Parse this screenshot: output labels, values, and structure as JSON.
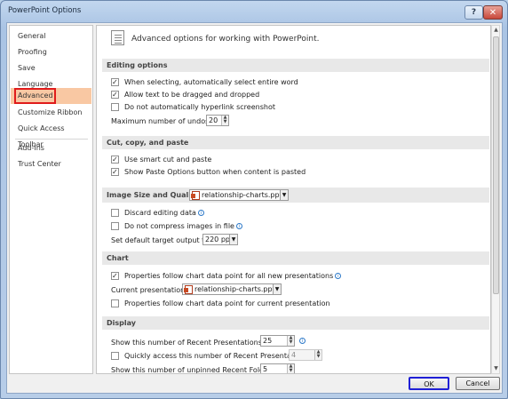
{
  "window": {
    "title": "PowerPoint Options",
    "help_glyph": "?",
    "close_glyph": "✕"
  },
  "nav": {
    "items": [
      {
        "label": "General"
      },
      {
        "label": "Proofing"
      },
      {
        "label": "Save"
      },
      {
        "label": "Language"
      },
      {
        "label": "Advanced",
        "selected": true
      },
      {
        "label": "Customize Ribbon"
      },
      {
        "label": "Quick Access Toolbar"
      },
      {
        "label": "Add-Ins"
      },
      {
        "label": "Trust Center"
      }
    ]
  },
  "header": {
    "text": "Advanced options for working with PowerPoint.",
    "icon": "options-page-icon"
  },
  "editing": {
    "title": "Editing options",
    "opt1": "When selecting, automatically select entire word",
    "opt2": "Allow text to be dragged and dropped",
    "opt3": "Do not automatically hyperlink screenshot",
    "undos_label": "Maximum number of undos:",
    "undos_value": "20"
  },
  "ccp": {
    "title": "Cut, copy, and paste",
    "opt1": "Use smart cut and paste",
    "opt2": "Show Paste Options button when content is pasted"
  },
  "image": {
    "title": "Image Size and Quality",
    "file": "relationship-charts.pptx",
    "opt1": "Discard editing data",
    "opt2": "Do not compress images in file",
    "target_label": "Set default target output to:",
    "target_value": "220 ppi"
  },
  "chart": {
    "title": "Chart",
    "opt1": "Properties follow chart data point for all new presentations",
    "current_label": "Current presentation:",
    "current_file": "relationship-charts.pptx",
    "opt2": "Properties follow chart data point for current presentation"
  },
  "display": {
    "title": "Display",
    "recent_label": "Show this number of Recent Presentations:",
    "recent_value": "25",
    "quick_label": "Quickly access this number of Recent Presentations:",
    "quick_value": "4",
    "folders_label": "Show this number of unpinned Recent Folders:",
    "folders_value": "5"
  },
  "buttons": {
    "ok": "OK",
    "cancel": "Cancel"
  }
}
